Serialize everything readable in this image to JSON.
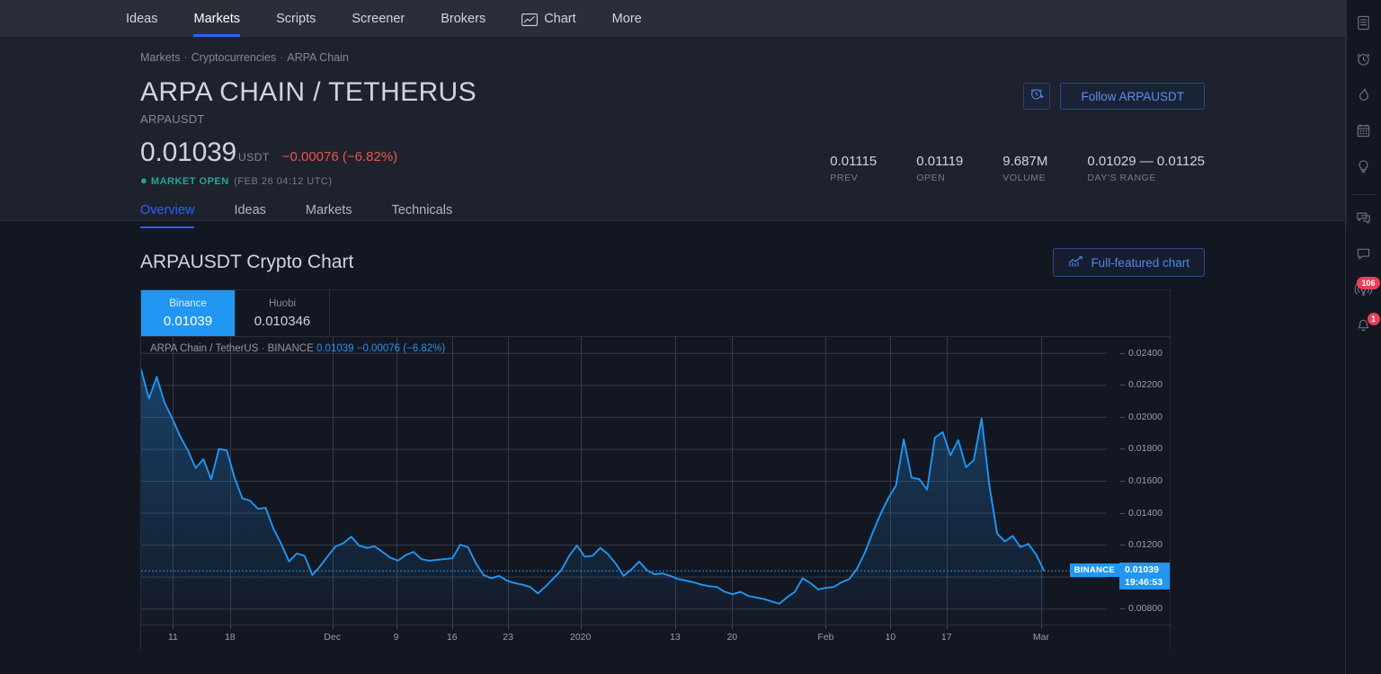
{
  "topnav": {
    "items": [
      {
        "label": "Ideas",
        "active": false,
        "icon": null
      },
      {
        "label": "Markets",
        "active": true,
        "icon": null
      },
      {
        "label": "Scripts",
        "active": false,
        "icon": null
      },
      {
        "label": "Screener",
        "active": false,
        "icon": null
      },
      {
        "label": "Brokers",
        "active": false,
        "icon": null
      },
      {
        "label": "Chart",
        "active": false,
        "icon": "chart-icon"
      },
      {
        "label": "More",
        "active": false,
        "icon": null
      }
    ]
  },
  "breadcrumb": {
    "items": [
      "Markets",
      "Cryptocurrencies",
      "ARPA Chain"
    ],
    "separator": "·"
  },
  "symbol": {
    "title": "ARPA CHAIN / TETHERUS",
    "ticker": "ARPAUSDT",
    "price": "0.01039",
    "currency": "USDT",
    "change": "−0.00076 (−6.82%)",
    "change_color": "#EF5350",
    "status_dot": "●",
    "status": "MARKET OPEN",
    "status_time": "(FEB 26 04:12 UTC)",
    "status_color": "#26A69A"
  },
  "header_actions": {
    "alert_icon": "alarm-clock-plus-icon",
    "follow_label": "Follow ARPAUSDT"
  },
  "stats": [
    {
      "value": "0.01115",
      "label": "PREV"
    },
    {
      "value": "0.01119",
      "label": "OPEN"
    },
    {
      "value": "9.687M",
      "label": "VOLUME"
    },
    {
      "value": "0.01029 — 0.01125",
      "label": "DAY'S RANGE"
    }
  ],
  "tabs": [
    {
      "label": "Overview",
      "active": true
    },
    {
      "label": "Ideas",
      "active": false
    },
    {
      "label": "Markets",
      "active": false
    },
    {
      "label": "Technicals",
      "active": false
    }
  ],
  "chart_section": {
    "title": "ARPAUSDT Crypto Chart",
    "full_featured_label": "Full-featured chart",
    "full_featured_icon": "chart-bars-icon",
    "exchange_tabs": [
      {
        "name": "Binance",
        "price": "0.01039",
        "active": true
      },
      {
        "name": "Huobi",
        "price": "0.010346",
        "active": false
      }
    ],
    "legend": {
      "symbol": "ARPA Chain / TetherUS",
      "separator": "·",
      "exchange": "BINANCE",
      "last": "0.01039",
      "change": "−0.00076 (−6.82%)"
    },
    "price_tag": "0.01039",
    "time_tag": "19:46:53",
    "axis_flag": "BINANCE",
    "accent_color": "#2196F3"
  },
  "chart_data": {
    "type": "area",
    "title": "ARPAUSDT Crypto Chart",
    "series_name": "ARPA Chain / TetherUS · BINANCE",
    "xlabel": "",
    "ylabel": "",
    "grid": true,
    "legend_position": "top-left",
    "ylim": [
      0.007,
      0.025
    ],
    "yticks": [
      "0.02400",
      "0.02200",
      "0.02000",
      "0.01800",
      "0.01600",
      "0.01400",
      "0.01200",
      "0.01000",
      "0.00800"
    ],
    "ytick_values": [
      0.024,
      0.022,
      0.02,
      0.018,
      0.016,
      0.014,
      0.012,
      0.01,
      0.008
    ],
    "xticks": [
      "11",
      "18",
      "Dec",
      "9",
      "16",
      "23",
      "2020",
      "13",
      "20",
      "Feb",
      "10",
      "17",
      "Mar"
    ],
    "xtick_positions": [
      0.033,
      0.092,
      0.198,
      0.264,
      0.322,
      0.38,
      0.455,
      0.553,
      0.612,
      0.709,
      0.776,
      0.834,
      0.932
    ],
    "current_price_line": 0.01039,
    "x": [
      0,
      1,
      2,
      3,
      4,
      5,
      6,
      7,
      8,
      9,
      10,
      11,
      12,
      13,
      14,
      15,
      16,
      17,
      18,
      19,
      20,
      21,
      22,
      23,
      24,
      25,
      26,
      27,
      28,
      29,
      30,
      31,
      32,
      33,
      34,
      35,
      36,
      37,
      38,
      39,
      40,
      41,
      42,
      43,
      44,
      45,
      46,
      47,
      48,
      49,
      50,
      51,
      52,
      53,
      54,
      55,
      56,
      57,
      58,
      59,
      60,
      61,
      62,
      63,
      64,
      65,
      66,
      67,
      68,
      69,
      70,
      71,
      72,
      73,
      74,
      75,
      76,
      77,
      78,
      79,
      80,
      81,
      82,
      83,
      84,
      85,
      86,
      87,
      88,
      89,
      90,
      91,
      92,
      93,
      94,
      95,
      96,
      97,
      98,
      99,
      100,
      101,
      102,
      103,
      104,
      105,
      106,
      107,
      108
    ],
    "values": [
      0.02295,
      0.02115,
      0.0225,
      0.0209,
      0.0199,
      0.0188,
      0.0179,
      0.0168,
      0.01735,
      0.0161,
      0.018,
      0.0179,
      0.0162,
      0.0149,
      0.01475,
      0.01425,
      0.0143,
      0.013,
      0.01205,
      0.01095,
      0.01145,
      0.0113,
      0.0101,
      0.01065,
      0.0113,
      0.0119,
      0.0121,
      0.0125,
      0.01195,
      0.0118,
      0.0119,
      0.01155,
      0.0112,
      0.011,
      0.01135,
      0.01155,
      0.0111,
      0.011,
      0.01105,
      0.0111,
      0.01115,
      0.012,
      0.01185,
      0.01085,
      0.0101,
      0.0099,
      0.01005,
      0.00975,
      0.0096,
      0.0095,
      0.00935,
      0.00895,
      0.0094,
      0.0099,
      0.0104,
      0.0113,
      0.01195,
      0.01125,
      0.0113,
      0.0118,
      0.0114,
      0.0108,
      0.01005,
      0.01045,
      0.01095,
      0.0104,
      0.01015,
      0.0102,
      0.01005,
      0.00985,
      0.00975,
      0.00965,
      0.0095,
      0.0094,
      0.00935,
      0.00905,
      0.0089,
      0.00905,
      0.0088,
      0.0087,
      0.0086,
      0.00845,
      0.0083,
      0.0087,
      0.00905,
      0.0099,
      0.0096,
      0.0092,
      0.0093,
      0.00935,
      0.00965,
      0.00985,
      0.0105,
      0.0115,
      0.01275,
      0.0139,
      0.0149,
      0.0157,
      0.0186,
      0.0162,
      0.0161,
      0.01545,
      0.0187,
      0.01905,
      0.0176,
      0.01855,
      0.01685,
      0.0173,
      0.0199,
      0.0157,
      0.0127,
      0.0122,
      0.01255,
      0.01185,
      0.01205,
      0.0114,
      0.01039
    ]
  },
  "rail": {
    "items": [
      {
        "icon": "watchlist-icon",
        "badge": null
      },
      {
        "icon": "alarm-clock-icon",
        "badge": null
      },
      {
        "icon": "hotlist-flame-icon",
        "badge": null
      },
      {
        "icon": "calendar-icon",
        "badge": null
      },
      {
        "icon": "lightbulb-idea-icon",
        "badge": null
      },
      {
        "icon": "chat-bubbles-icon",
        "badge": null
      },
      {
        "icon": "chat-single-icon",
        "badge": null
      },
      {
        "icon": "broadcast-icon",
        "badge": "106"
      },
      {
        "icon": "bell-notification-icon",
        "badge": "1"
      }
    ],
    "badge_color": "#E8415A"
  }
}
